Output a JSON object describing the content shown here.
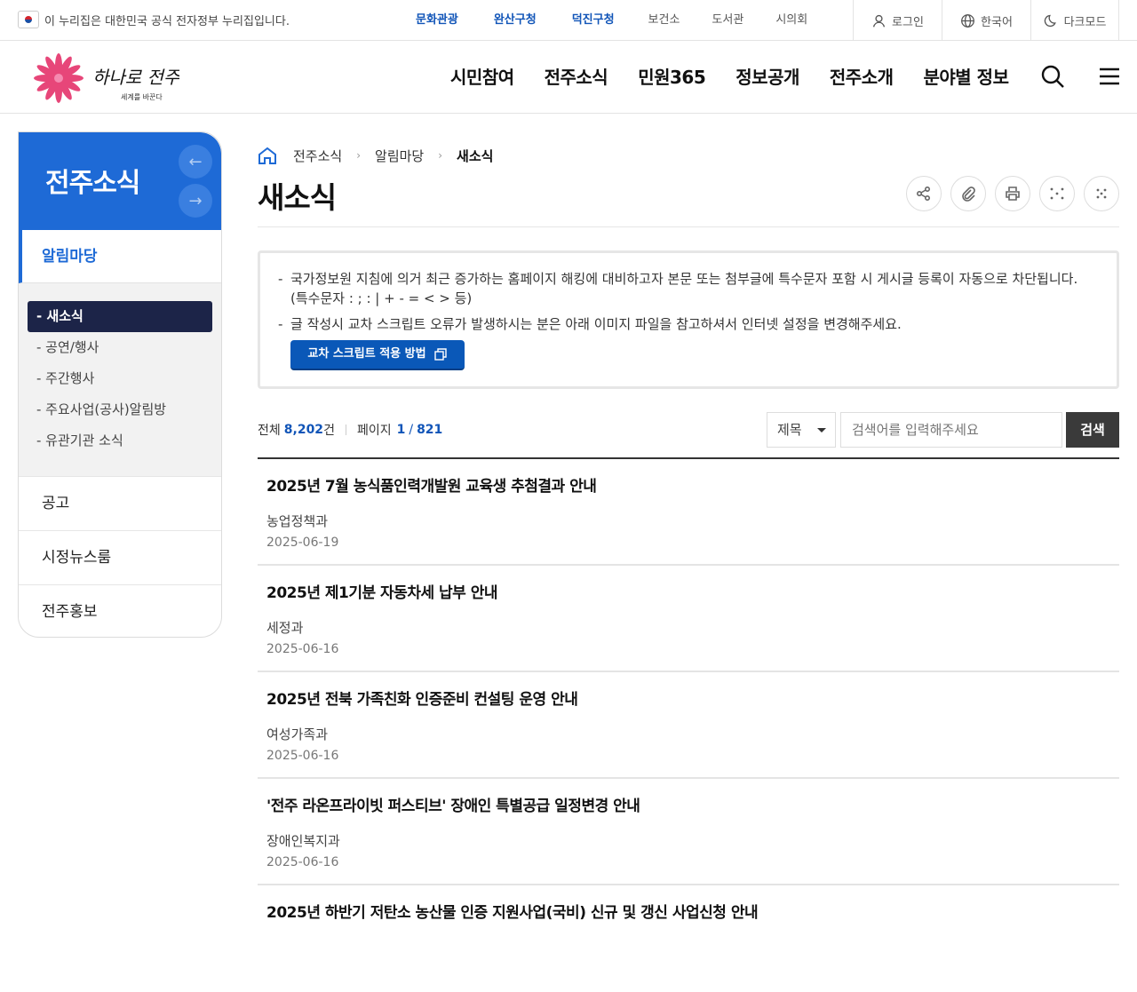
{
  "topbar": {
    "gov_notice": "이 누리집은 대한민국 공식 전자정부 누리집입니다.",
    "site_links": [
      {
        "label": "문화관광",
        "highlight": true
      },
      {
        "label": "완산구청",
        "highlight": true
      },
      {
        "label": "덕진구청",
        "highlight": true
      },
      {
        "label": "보건소",
        "highlight": false
      },
      {
        "label": "도서관",
        "highlight": false
      },
      {
        "label": "시의회",
        "highlight": false
      }
    ],
    "login": "로그인",
    "language": "한국어",
    "dark_mode": "다크모드"
  },
  "header": {
    "logo_text": "하나로 전주",
    "logo_sub": "세계를 바꾼다",
    "gnb": [
      "시민참여",
      "전주소식",
      "민원365",
      "정보공개",
      "전주소개",
      "분야별 정보"
    ]
  },
  "sidebar": {
    "title": "전주소식",
    "selected_section": "알림마당",
    "sub_items": [
      {
        "label": "- 새소식",
        "active": true
      },
      {
        "label": "- 공연/행사",
        "active": false
      },
      {
        "label": "- 주간행사",
        "active": false
      },
      {
        "label": "- 주요사업(공사)알림방",
        "active": false
      },
      {
        "label": "- 유관기관 소식",
        "active": false
      }
    ],
    "other_sections": [
      "공고",
      "시정뉴스룸",
      "전주홍보"
    ]
  },
  "breadcrumb": [
    "전주소식",
    "알림마당",
    "새소식"
  ],
  "page_title": "새소식",
  "notice": {
    "line1": "국가정보원 지침에 의거 최근 증가하는 홈페이지 해킹에 대비하고자 본문 또는 첨부글에 특수문자 포함 시 게시글 등록이 자동으로 차단됩니다. (특수문자 : ; : | + - = < > 등)",
    "line2": "글 작성시 교차 스크립트 오류가 발생하시는 분은 아래 이미지 파일을 참고하셔서 인터넷 설정을 변경해주세요.",
    "button": "교차 스크립트 적용 방법"
  },
  "board": {
    "total_label": "전체",
    "total_count": "8,202",
    "total_unit": "건",
    "page_label": "페이지",
    "page_current": "1",
    "page_sep": "/",
    "page_total": "821",
    "search_field": "제목",
    "search_placeholder": "검색어를 입력해주세요",
    "search_button": "검색",
    "posts": [
      {
        "title": "2025년 7월 농식품인력개발원 교육생 추첨결과 안내",
        "dept": "농업정책과",
        "date": "2025-06-19"
      },
      {
        "title": "2025년 제1기분 자동차세 납부 안내",
        "dept": "세정과",
        "date": "2025-06-16"
      },
      {
        "title": "2025년 전북 가족친화 인증준비 컨설팅 운영 안내",
        "dept": "여성가족과",
        "date": "2025-06-16"
      },
      {
        "title": "'전주 라온프라이빗 퍼스티브' 장애인 특별공급 일정변경 안내",
        "dept": "장애인복지과",
        "date": "2025-06-16"
      },
      {
        "title": "2025년 하반기 저탄소 농산물 인증 지원사업(국비) 신규 및 갱신 사업신청 안내",
        "dept": "",
        "date": ""
      }
    ]
  },
  "colors": {
    "primary": "#1e6ad6",
    "active_sub": "#1c2448",
    "button": "#0a58b8",
    "link_blue": "#1155b8"
  }
}
